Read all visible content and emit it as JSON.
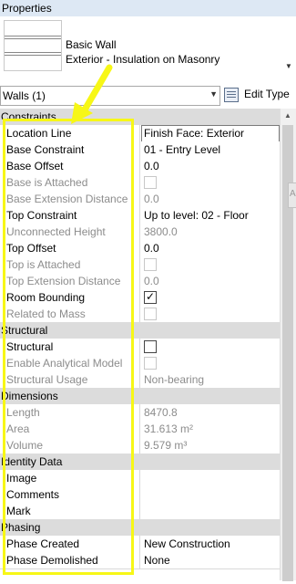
{
  "title": "Properties",
  "type_selector": {
    "family": "Basic Wall",
    "type": "Exterior - Insulation on Masonry"
  },
  "selection": {
    "label": "Walls (1)",
    "edit_type": "Edit Type"
  },
  "right_stub_glyph": "A",
  "sections": {
    "constraints": "Constraints",
    "structural": "Structural",
    "dimensions": "Dimensions",
    "identity": "Identity Data",
    "phasing": "Phasing"
  },
  "constraints": {
    "location_line": {
      "label": "Location Line",
      "value": "Finish Face: Exterior"
    },
    "base_constraint": {
      "label": "Base Constraint",
      "value": "01 - Entry Level"
    },
    "base_offset": {
      "label": "Base Offset",
      "value": "0.0"
    },
    "base_attached": {
      "label": "Base is Attached",
      "checked": false,
      "enabled": false
    },
    "base_ext": {
      "label": "Base Extension Distance",
      "value": "0.0"
    },
    "top_constraint": {
      "label": "Top Constraint",
      "value": "Up to level: 02 - Floor"
    },
    "unconnected_height": {
      "label": "Unconnected Height",
      "value": "3800.0"
    },
    "top_offset": {
      "label": "Top Offset",
      "value": "0.0"
    },
    "top_attached": {
      "label": "Top is Attached",
      "checked": false,
      "enabled": false
    },
    "top_ext": {
      "label": "Top Extension Distance",
      "value": "0.0"
    },
    "room_bounding": {
      "label": "Room Bounding",
      "checked": true,
      "enabled": true
    },
    "related_mass": {
      "label": "Related to Mass",
      "checked": false,
      "enabled": false
    }
  },
  "structural": {
    "structural": {
      "label": "Structural",
      "checked": false,
      "enabled": true
    },
    "analytical": {
      "label": "Enable Analytical Model",
      "checked": false,
      "enabled": false
    },
    "usage": {
      "label": "Structural Usage",
      "value": "Non-bearing"
    }
  },
  "dimensions": {
    "length": {
      "label": "Length",
      "value": "8470.8"
    },
    "area": {
      "label": "Area",
      "value": "31.613 m²"
    },
    "volume": {
      "label": "Volume",
      "value": "9.579 m³"
    }
  },
  "identity": {
    "image": {
      "label": "Image",
      "value": ""
    },
    "comments": {
      "label": "Comments",
      "value": ""
    },
    "mark": {
      "label": "Mark",
      "value": ""
    }
  },
  "phasing": {
    "created": {
      "label": "Phase Created",
      "value": "New Construction"
    },
    "demolished": {
      "label": "Phase Demolished",
      "value": "None"
    }
  },
  "icons": {
    "dropdown": "chevron-down-icon",
    "edit_type": "edit-type-icon",
    "checkbox_tick": "✓"
  },
  "annotation_color": "#f7f716"
}
